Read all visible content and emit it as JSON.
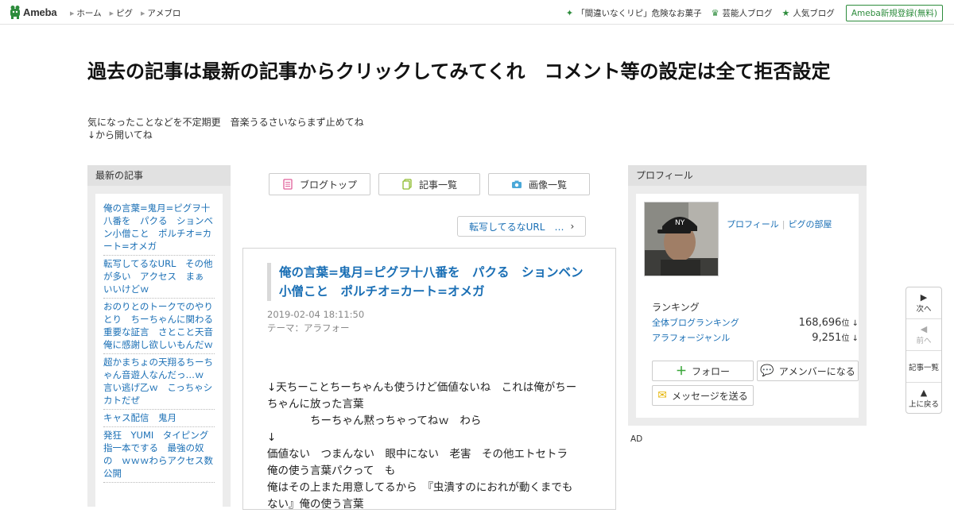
{
  "topbar": {
    "logo": "Ameba",
    "nav": [
      "ホーム",
      "ピグ",
      "アメブロ"
    ],
    "links": [
      {
        "label": "「間違いなくリピ」危険なお菓子",
        "icon": "sparkle-icon"
      },
      {
        "label": "芸能人ブログ",
        "icon": "crown-icon"
      },
      {
        "label": "人気ブログ",
        "icon": "star-icon"
      }
    ],
    "register": "Ameba新規登録(無料)"
  },
  "header": {
    "title": "過去の記事は最新の記事からクリックしてみてくれ　コメント等の設定は全て拒否設定",
    "description_lines": [
      "気になったことなどを不定期更　音楽うるさいならまず止めてね",
      "↓から開いてね"
    ]
  },
  "sidebar_left": {
    "heading": "最新の記事",
    "items": [
      "俺の言葉=鬼月=ピグヲ十八番を　パクる　ションベン小僧こと　ポルチオ=カート=オメガ",
      "転写してるなURL　その他　が多い　アクセス　まぁ　いいけどｗ",
      "おのりとのトークでのやりとり　ちーちゃんに関わる重要な証言　さとこと天音俺に感謝し欲しいもんだｗ",
      "超かまちょの天翔るちーちゃん音遊人なんだっ…ｗ　言い逃げ乙ｗ　こっちゃシカトだぜ",
      "キャス配信　鬼月",
      "発狂　YUMI　タイピング指一本でする　最強の奴　の　ｗｗｗわらアクセス数公開"
    ]
  },
  "center": {
    "buttons": [
      "ブログトップ",
      "記事一覧",
      "画像一覧"
    ],
    "prev_entry": "転写してるなURL　…",
    "entry": {
      "title": "俺の言葉=鬼月=ピグヲ十八番を　パクる　ションベン小僧こと　ポルチオ=カート=オメガ",
      "date": "2019-02-04 18:11:50",
      "theme_label": "テーマ：",
      "theme": "アラフォー",
      "body_lines": [
        "↓天ちーことちーちゃんも使うけど価値ないね　これは俺がちー",
        "ちゃんに放った言葉",
        "　　　　ちーちゃん黙っちゃってねｗ　わら",
        "↓",
        "価値ない　つまんない　眼中にない　老害　その他エトセトラ",
        "俺の使う言葉パクって　も",
        "俺はその上また用意してるから　『虫潰すのにおれが動くまでも",
        "ない』俺の使う言葉"
      ]
    }
  },
  "sidebar_right": {
    "heading": "プロフィール",
    "profile_link": "プロフィール",
    "pig_link": "ピグの部屋",
    "ranking_heading": "ランキング",
    "rankings": [
      {
        "label": "全体ブログランキング",
        "value": "168,696",
        "unit": "位 ↓"
      },
      {
        "label": "アラフォージャンル",
        "value": "9,251",
        "unit": "位 ↓"
      }
    ],
    "follow": "フォロー",
    "amember": "アメンバーになる",
    "message": "メッセージを送る",
    "ad": "AD"
  },
  "side_nav": {
    "next": "次へ",
    "prev": "前へ",
    "list": "記事一覧",
    "top": "上に戻る"
  }
}
